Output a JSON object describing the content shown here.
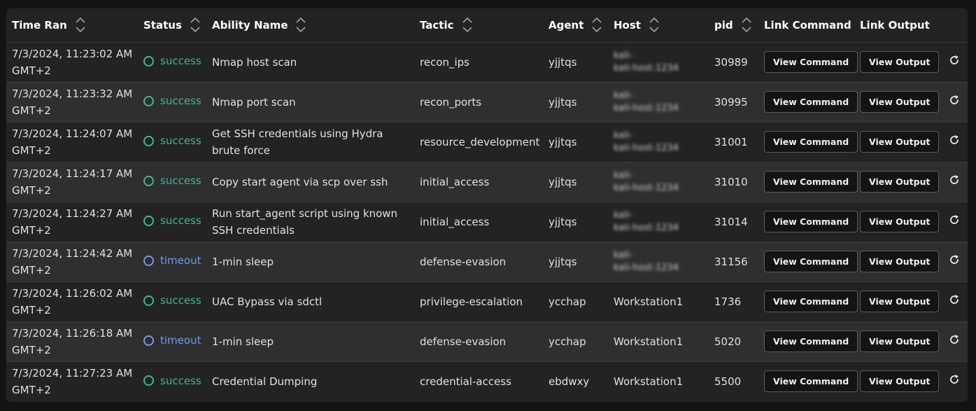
{
  "headers": {
    "time_ran": "Time Ran",
    "status": "Status",
    "ability_name": "Ability Name",
    "tactic": "Tactic",
    "agent": "Agent",
    "host": "Host",
    "pid": "pid",
    "link_command": "Link Command",
    "link_output": "Link Output"
  },
  "buttons": {
    "view_command": "View Command",
    "view_output": "View Output"
  },
  "icons": {
    "sort": "sort-updown-icon",
    "rerun": "refresh-icon",
    "status": "status-ring-icon"
  },
  "colors": {
    "success": "#3bb894",
    "timeout": "#6f9af0"
  },
  "rows": [
    {
      "time": "7/3/2024, 11:23:02 AM",
      "tz": "GMT+2",
      "status": "success",
      "ability": "Nmap host scan",
      "tactic": "recon_ips",
      "agent": "yjjtqs",
      "host_l1": "kali-",
      "host_l2": "kali-host-1234",
      "pid": "30989"
    },
    {
      "time": "7/3/2024, 11:23:32 AM",
      "tz": "GMT+2",
      "status": "success",
      "ability": "Nmap port scan",
      "tactic": "recon_ports",
      "agent": "yjjtqs",
      "host_l1": "kali-",
      "host_l2": "kali-host-1234",
      "pid": "30995"
    },
    {
      "time": "7/3/2024, 11:24:07 AM",
      "tz": "GMT+2",
      "status": "success",
      "ability": "Get SSH credentials using Hydra brute force",
      "tactic": "resource_development",
      "agent": "yjjtqs",
      "host_l1": "kali-",
      "host_l2": "kali-host-1234",
      "pid": "31001"
    },
    {
      "time": "7/3/2024, 11:24:17 AM",
      "tz": "GMT+2",
      "status": "success",
      "ability": "Copy start agent via scp over ssh",
      "tactic": "initial_access",
      "agent": "yjjtqs",
      "host_l1": "kali-",
      "host_l2": "kali-host-1234",
      "pid": "31010"
    },
    {
      "time": "7/3/2024, 11:24:27 AM",
      "tz": "GMT+2",
      "status": "success",
      "ability": "Run start_agent script using known SSH credentials",
      "tactic": "initial_access",
      "agent": "yjjtqs",
      "host_l1": "kali-",
      "host_l2": "kali-host-1234",
      "pid": "31014"
    },
    {
      "time": "7/3/2024, 11:24:42 AM",
      "tz": "GMT+2",
      "status": "timeout",
      "ability": "1-min sleep",
      "tactic": "defense-evasion",
      "agent": "yjjtqs",
      "host_l1": "kali-",
      "host_l2": "kali-host-1234",
      "pid": "31156"
    },
    {
      "time": "7/3/2024, 11:26:02 AM",
      "tz": "GMT+2",
      "status": "success",
      "ability": "UAC Bypass via sdctl",
      "tactic": "privilege-escalation",
      "agent": "ycchap",
      "host": "Workstation1",
      "pid": "1736"
    },
    {
      "time": "7/3/2024, 11:26:18 AM",
      "tz": "GMT+2",
      "status": "timeout",
      "ability": "1-min sleep",
      "tactic": "defense-evasion",
      "agent": "ycchap",
      "host": "Workstation1",
      "pid": "5020"
    },
    {
      "time": "7/3/2024, 11:27:23 AM",
      "tz": "GMT+2",
      "status": "success",
      "ability": "Credential Dumping",
      "tactic": "credential-access",
      "agent": "ebdwxy",
      "host": "Workstation1",
      "pid": "5500"
    }
  ]
}
